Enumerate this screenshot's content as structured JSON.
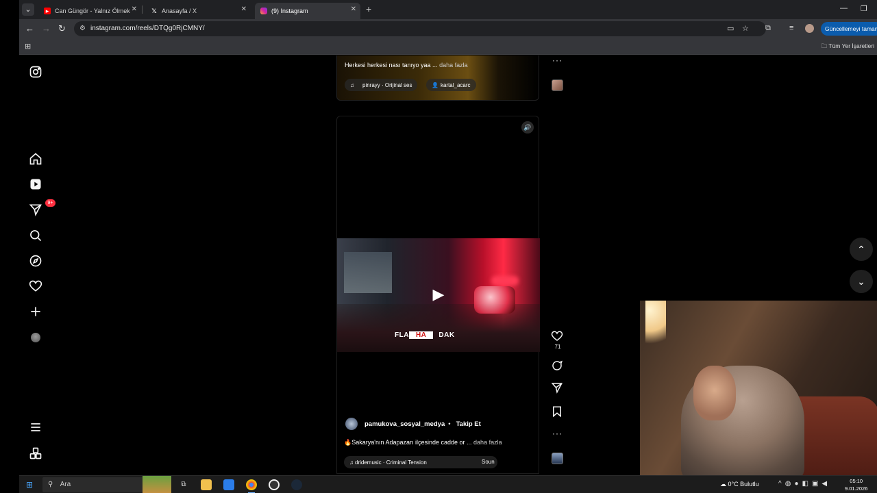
{
  "browser": {
    "tabs": [
      {
        "title": "Can Güngör - Yalnız Ölmek - Yo",
        "favicon": "youtube-icon"
      },
      {
        "title": "Anasayfa / X",
        "favicon": "x-icon"
      },
      {
        "title": "(9) Instagram",
        "favicon": "instagram-icon",
        "active": true
      }
    ],
    "url": "instagram.com/reels/DTQg0RjCMNY/",
    "update_button": "Güncellemeyi tamamla",
    "all_bookmarks": "Tüm Yer İşaretleri"
  },
  "sidebar": {
    "notification_badge": "9+"
  },
  "reel_top": {
    "caption": "Herkesi herkesi nası tanıyo yaa ...",
    "more": "daha fazla",
    "audio": "pinrayy · Orijinal ses",
    "tagged_user": "kartal_acarc"
  },
  "reel_main": {
    "overlay_text_left": "FLA",
    "overlay_text_highlight": "HA",
    "overlay_text_right": "DAK",
    "author": "pamukova_sosyal_medya",
    "separator": "•",
    "follow_label": "Takip Et",
    "caption": "🔥Sakarya'nın Adapazarı ilçesinde cadde or ...",
    "more": "daha fazla",
    "audio": "dridemusic · Criminal Tension",
    "sound_label": "Soun",
    "like_count": "71"
  },
  "taskbar": {
    "search_placeholder": "Ara",
    "weather": "0°C  Bulutlu",
    "time": "05:10",
    "date": "9.01.2026"
  },
  "colors": {
    "instagram_bg": "#000000",
    "browser_bar": "#35363a",
    "badge": "#ff3040",
    "update_button": "#0b5cad"
  }
}
